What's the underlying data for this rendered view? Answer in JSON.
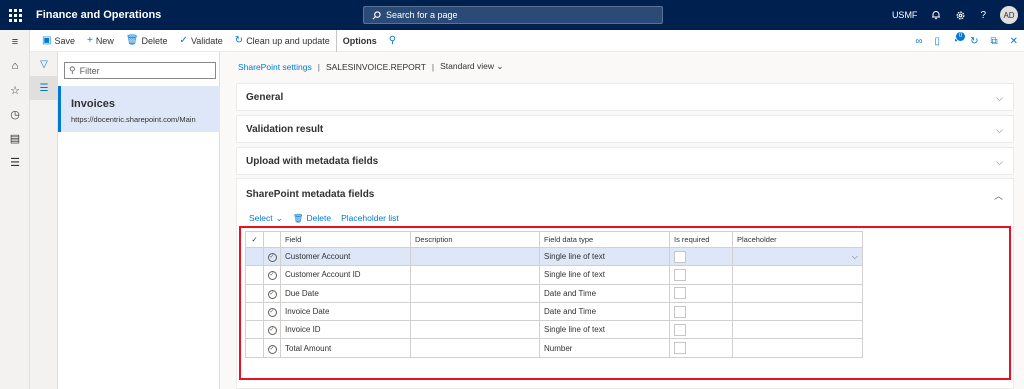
{
  "app": {
    "title": "Finance and Operations",
    "search_placeholder": "Search for a page",
    "company": "USMF",
    "user_initials": "AD",
    "notification_count": "0"
  },
  "actions": {
    "save": "Save",
    "new": "New",
    "delete": "Delete",
    "validate": "Validate",
    "cleanup": "Clean up and update",
    "options": "Options"
  },
  "list": {
    "filter_placeholder": "Filter",
    "item_title": "Invoices",
    "item_url": "https://docentric.sharepoint.com/Main"
  },
  "breadcrumb": {
    "page": "SharePoint settings",
    "separator": "|",
    "record": "SALESINVOICE.REPORT",
    "view": "Standard view"
  },
  "fasttabs": [
    "General",
    "Validation result",
    "Upload with metadata fields",
    "SharePoint metadata fields"
  ],
  "gridbar": {
    "select": "Select",
    "delete": "Delete",
    "placeholder_list": "Placeholder list"
  },
  "grid": {
    "columns": [
      "Field",
      "Description",
      "Field data type",
      "Is required",
      "Placeholder"
    ],
    "rows": [
      {
        "field": "Customer Account",
        "description": "",
        "type": "Single line of text"
      },
      {
        "field": "Customer Account ID",
        "description": "",
        "type": "Single line of text"
      },
      {
        "field": "Due Date",
        "description": "",
        "type": "Date and Time"
      },
      {
        "field": "Invoice Date",
        "description": "",
        "type": "Date and Time"
      },
      {
        "field": "Invoice ID",
        "description": "",
        "type": "Single line of text"
      },
      {
        "field": "Total Amount",
        "description": "",
        "type": "Number"
      }
    ]
  },
  "colors": {
    "nav_bar": "#002050",
    "accent": "#0078d4",
    "selection": "#dde7f7",
    "highlight_border": "#e81123"
  }
}
